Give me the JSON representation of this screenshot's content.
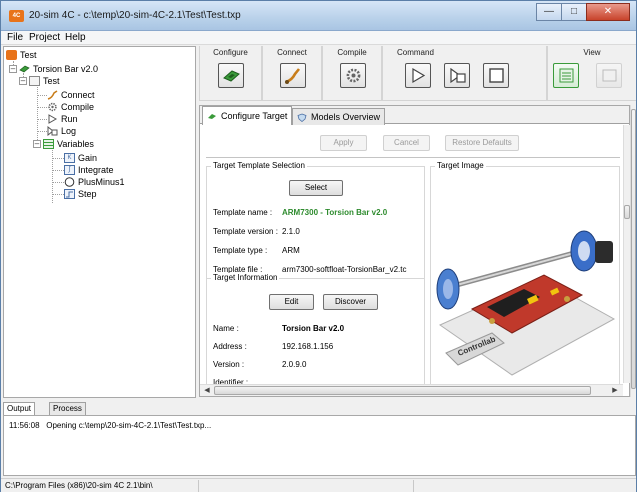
{
  "window": {
    "title": "20-sim 4C - c:\\temp\\20-sim-4C-2.1\\Test\\Test.txp",
    "app_badge": "4C"
  },
  "menu": [
    "File",
    "Project",
    "Help"
  ],
  "tree": {
    "nodes": [
      "Test",
      "Torsion Bar v2.0",
      "Test",
      "Connect",
      "Compile",
      "Run",
      "Log",
      "Variables",
      "Gain",
      "Integrate",
      "PlusMinus1",
      "Step"
    ]
  },
  "toolbar": {
    "groups": {
      "configure": "Configure",
      "connect": "Connect",
      "compile": "Compile",
      "command": "Command",
      "view": "View"
    }
  },
  "tabs": {
    "configure_target": "Configure Target",
    "models_overview": "Models Overview"
  },
  "actions": {
    "apply": "Apply",
    "cancel": "Cancel",
    "restore": "Restore Defaults"
  },
  "template": {
    "section_title": "Target Template Selection",
    "select_label": "Select",
    "name_label": "Template name :",
    "name_value": "ARM7300 - Torsion Bar v2.0",
    "version_label": "Template version :",
    "version_value": "2.1.0",
    "type_label": "Template type :",
    "type_value": "ARM",
    "file_label": "Template file :",
    "file_value": "arm7300-softfloat-TorsionBar_v2.tc"
  },
  "target_info": {
    "section_title": "Target Information",
    "edit_label": "Edit",
    "discover_label": "Discover",
    "name_label": "Name :",
    "name_value": "Torsion Bar v2.0",
    "address_label": "Address :",
    "address_value": "192.168.1.156",
    "version_label": "Version :",
    "version_value": "2.0.9.0",
    "identifier_label": "Identifier :"
  },
  "target_image": {
    "section_title": "Target Image",
    "brand": "Controllab"
  },
  "output": {
    "tabs": [
      "Output",
      "Process"
    ],
    "lines": [
      {
        "time": "11:56:08",
        "message": "Opening c:\\temp\\20-sim-4C-2.1\\Test\\Test.txp..."
      }
    ]
  },
  "status": {
    "path": "C:\\Program Files (x86)\\20-sim 4C 2.1\\bin\\"
  },
  "colors": {
    "accent_green": "#2e8b2e",
    "app_orange": "#e8731a",
    "close_red": "#c8432b"
  }
}
